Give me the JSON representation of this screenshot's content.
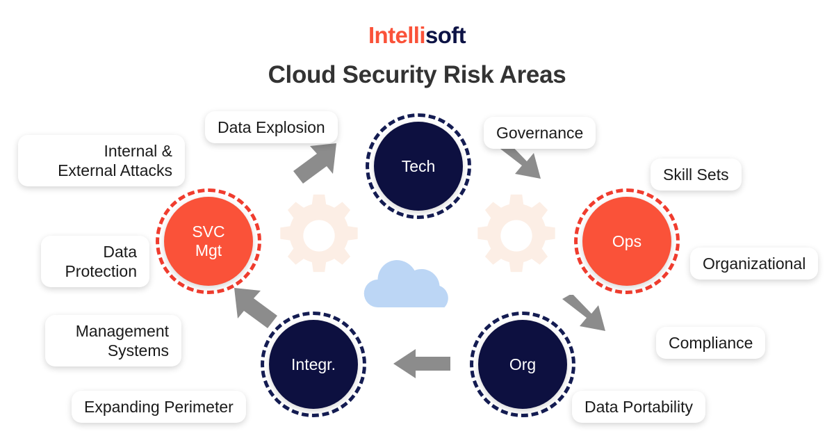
{
  "brand": {
    "logo_part_one": "Intelli",
    "logo_part_two": "soft",
    "logo_color_one": "#fa5239",
    "logo_color_two": "#0d1345"
  },
  "header": {
    "title": "Cloud Security Risk Areas",
    "title_color": "#333333"
  },
  "diagram": {
    "type": "cycle-diagram",
    "background": "#ffffff",
    "nodes": [
      {
        "id": "tech",
        "label": "Tech",
        "fill": "#0d1040",
        "ring": "#141c52",
        "style": "navy"
      },
      {
        "id": "ops",
        "label": "Ops",
        "fill": "#fa5239",
        "ring": "#f03c2e",
        "style": "orange"
      },
      {
        "id": "org",
        "label": "Org",
        "fill": "#0d1040",
        "ring": "#141c52",
        "style": "navy"
      },
      {
        "id": "integr",
        "label": "Integr.",
        "fill": "#0d1040",
        "ring": "#141c52",
        "style": "navy"
      },
      {
        "id": "svcmgt",
        "label": "SVC\nMgt",
        "fill": "#fa5239",
        "ring": "#f03c2e",
        "style": "orange"
      }
    ],
    "node_labels": {
      "tech": "Tech",
      "ops": "Ops",
      "org": "Org",
      "integr": "Integr.",
      "svcmgt_line1": "SVC",
      "svcmgt_line2": "Mgt"
    },
    "risk_labels": {
      "data_explosion": "Data Explosion",
      "governance": "Governance",
      "internal_external_attacks_line1": "Internal &",
      "internal_external_attacks_line2": "External Attacks",
      "skill_sets": "Skill Sets",
      "data_protection_line1": "Data",
      "data_protection_line2": "Protection",
      "organizational": "Organizational",
      "management_systems_line1": "Management",
      "management_systems_line2": "Systems",
      "compliance": "Compliance",
      "expanding_perimeter": "Expanding Perimeter",
      "data_portability": "Data Portability"
    },
    "decor": {
      "cloud_color": "#bcd6f5",
      "gear_color": "#fceee5",
      "arrow_color": "#8c8c8c"
    }
  }
}
